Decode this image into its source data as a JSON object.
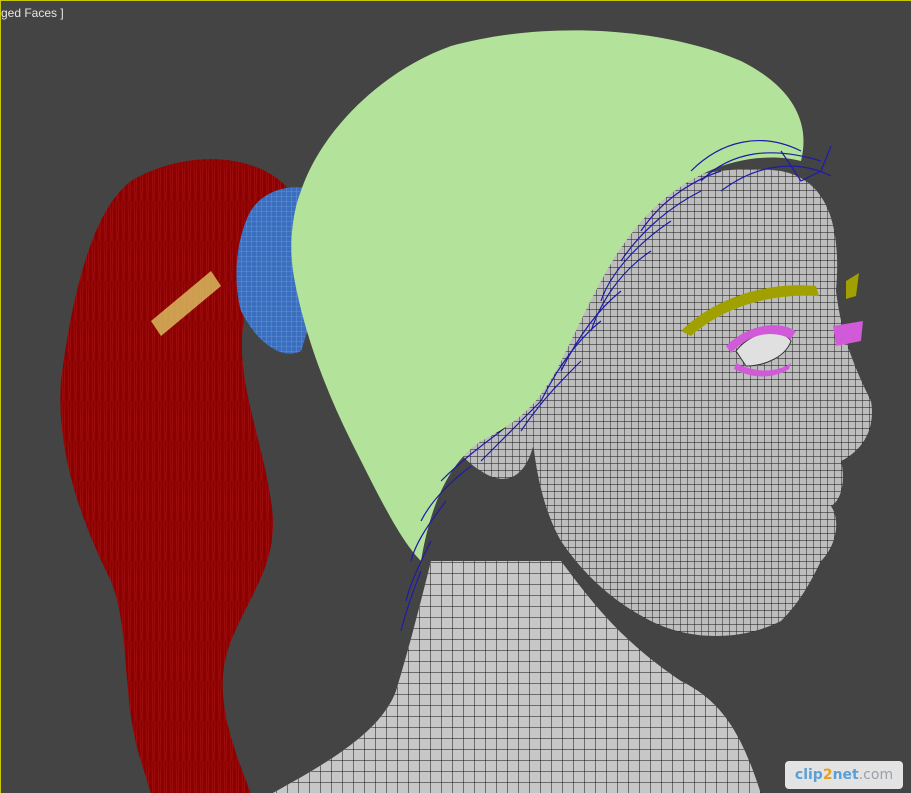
{
  "viewport": {
    "label": "ged Faces ]",
    "background": "#444444",
    "border_color": "#c8c800"
  },
  "scene": {
    "colors": {
      "ponytail": "#8b0000",
      "hair_tie": "#3a6fc0",
      "hair_cap": "#b3e39a",
      "stray_hair": "#1c1ca8",
      "skin_mesh": "#c7c7c7",
      "wireframe": "#111111",
      "eyebrow": "#a0a000",
      "eyelash": "#d05ad8"
    }
  },
  "watermark": {
    "part1": "clip",
    "part2": "2",
    "part3": "net",
    "part4": ".com"
  }
}
